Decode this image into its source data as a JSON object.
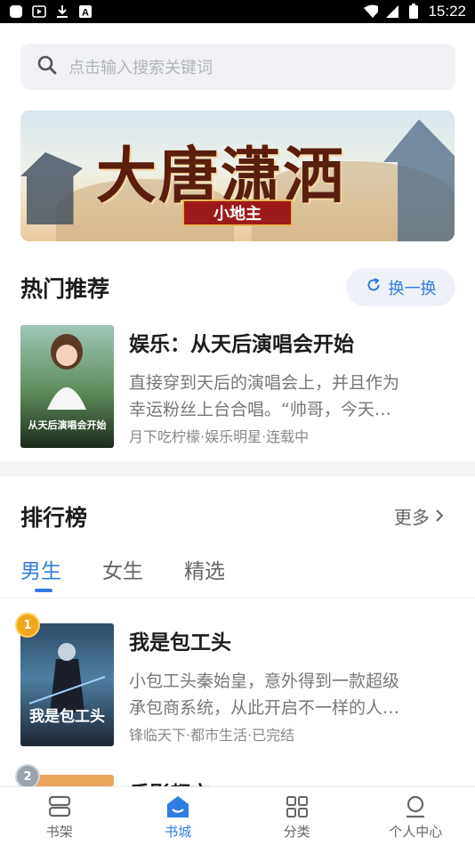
{
  "status_bar": {
    "time": "15:22"
  },
  "search": {
    "placeholder": "点击输入搜索关键词"
  },
  "banner": {
    "title": "大唐潇洒",
    "subtitle": "小地主"
  },
  "hot": {
    "title": "热门推荐",
    "refresh_label": "换一换",
    "book": {
      "title": "娱乐：从天后演唱会开始",
      "desc_line1": "直接穿到天后的演唱会上，并且作为",
      "desc_line2": "幸运粉丝上台合唱。“帅哥，今天…",
      "meta": "月下吃柠檬·娱乐明星·连载中",
      "cover_text": "从天后演唱会开始"
    }
  },
  "ranking": {
    "title": "排行榜",
    "more_label": "更多",
    "tabs": [
      "男生",
      "女生",
      "精选"
    ],
    "active_tab": 0,
    "books": [
      {
        "rank": "1",
        "title": "我是包工头",
        "desc_line1": "小包工头秦始皇，意外得到一款超级",
        "desc_line2": "承包商系统，从此开启不一样的人…",
        "meta": "锋临天下·都市生活·已完结",
        "cover_text": "我是包工头"
      },
      {
        "rank": "2",
        "title": "乐影都市"
      }
    ]
  },
  "bottom_nav": [
    {
      "label": "书架",
      "icon": "bookshelf-icon"
    },
    {
      "label": "书城",
      "icon": "bookstore-icon",
      "active": true
    },
    {
      "label": "分类",
      "icon": "category-grid-icon"
    },
    {
      "label": "个人中心",
      "icon": "person-icon"
    }
  ],
  "colors": {
    "accent": "#2f7de1",
    "text_primary": "#1c1c1c",
    "text_secondary": "#777777"
  }
}
